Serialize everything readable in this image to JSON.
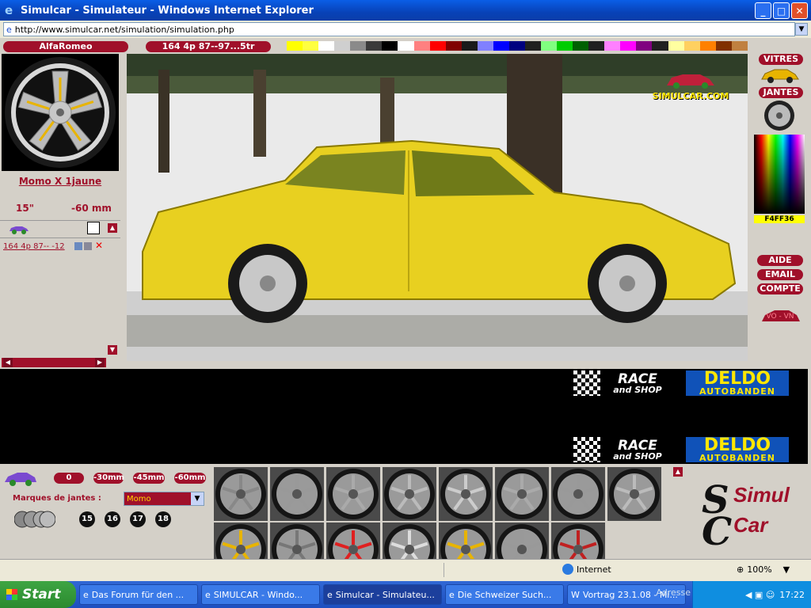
{
  "window": {
    "title": "Simulcar - Simulateur - Windows Internet Explorer",
    "url": "http://www.simulcar.net/simulation/simulation.php"
  },
  "top": {
    "brand": "AlfaRomeo",
    "model": "164 4p 87--97...5tr"
  },
  "palette": [
    "#ffff00",
    "#ffff40",
    "#ffffff",
    "#cfcfcf",
    "#8a8a8a",
    "#3a3a3a",
    "#000000",
    "#ffffff",
    "#ff8080",
    "#ff0000",
    "#800000",
    "#1a1a1a",
    "#8080ff",
    "#0000ff",
    "#000080",
    "#202020",
    "#80ff80",
    "#00cc00",
    "#006000",
    "#202020",
    "#ff80ff",
    "#ff00ff",
    "#800080",
    "#202020",
    "#ffffa0",
    "#ffd060",
    "#ff8000",
    "#803000",
    "#c08040"
  ],
  "wheel": {
    "name": "Momo X 1jaune",
    "size": "15\"",
    "offset": "-60 mm",
    "saved": "164 4p 87-- -12"
  },
  "right": {
    "vitres": "VITRES",
    "jantes": "JANTES",
    "hex": "F4FF36",
    "aide": "AIDE",
    "email": "EMAIL",
    "compte": "COMPTE",
    "vo": "VO - VN",
    "logo": "SIMULCAR.COM"
  },
  "ads": [
    {
      "race": "RACE",
      "shop": "and SHOP",
      "deldo": "DELDO",
      "auto": "AUTOBANDEN"
    },
    {
      "race": "RACE",
      "shop": "and SHOP",
      "deldo": "DELDO",
      "auto": "AUTOBANDEN"
    }
  ],
  "bottom": {
    "offsets": [
      "0",
      "-30mm",
      "-45mm",
      "-60mm"
    ],
    "brand_label": "Marques de jantes :",
    "brand_value": "Momo",
    "sizes": [
      "15",
      "16",
      "17",
      "18"
    ],
    "logo1": "Simul",
    "logo2": "Car"
  },
  "status": {
    "zone": "Internet",
    "zoom": "100%"
  },
  "taskbar": {
    "start": "Start",
    "tasks": [
      "Das Forum für den ...",
      "SIMULCAR - Windo...",
      "Simulcar - Simulateu...",
      "Die Schweizer Such...",
      "Vortrag 23.1.08 - Mi..."
    ],
    "adresse": "Adresse",
    "clock": "17:22"
  }
}
